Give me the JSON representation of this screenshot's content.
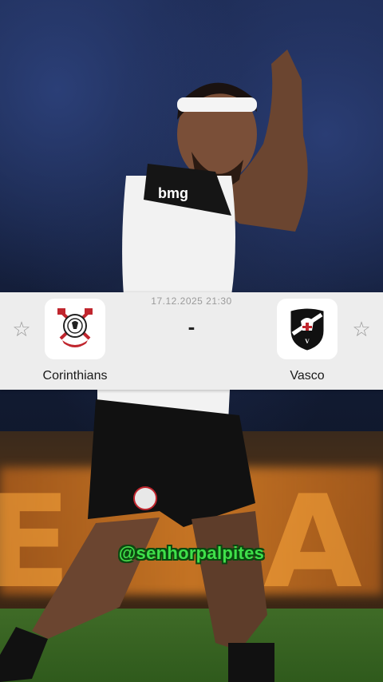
{
  "match": {
    "datetime": "17.12.2025 21:30",
    "separator": "-",
    "home": {
      "name": "Corinthians",
      "logo_icon": "corinthians-crest-icon"
    },
    "away": {
      "name": "Vasco",
      "logo_icon": "vasco-crest-icon"
    },
    "favorite_icon": "star-outline-icon"
  },
  "watermark": {
    "text": "@senhorpalpites"
  },
  "photo": {
    "subject": "player-celebration-photo",
    "shirt_sponsor": "bmg"
  },
  "colors": {
    "card_bg": "#ededed",
    "watermark_fill": "#3fe04a",
    "watermark_outline": "#0b4a10"
  }
}
